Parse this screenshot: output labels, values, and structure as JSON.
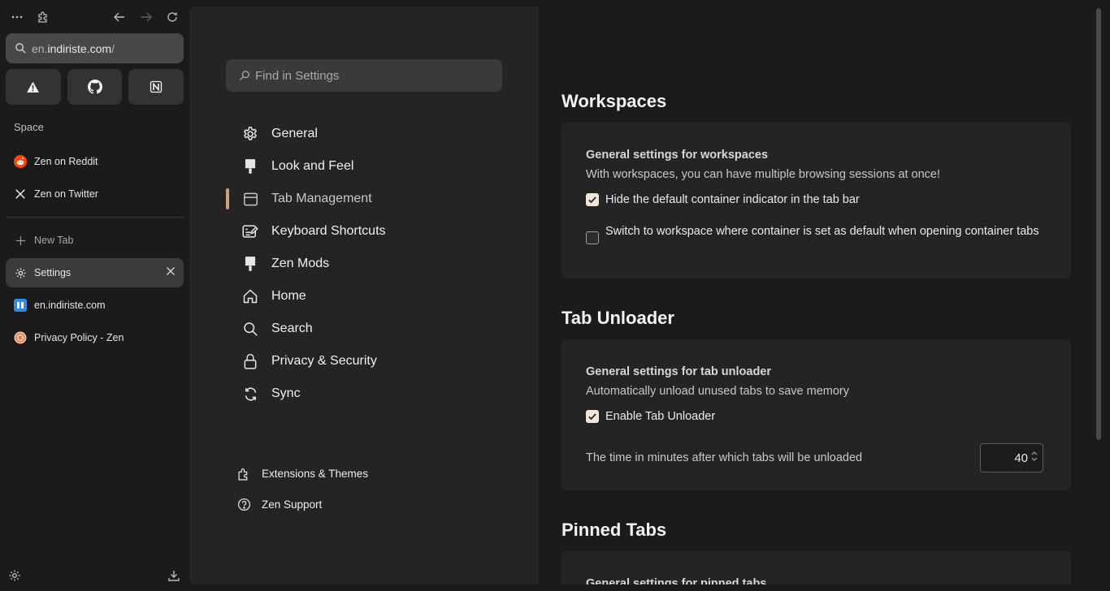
{
  "sidebar": {
    "url": {
      "prefix": "en.",
      "domain": "indiriste.com",
      "suffix": "/"
    },
    "pinned": [
      {
        "icon": "warning-icon"
      },
      {
        "icon": "github-icon"
      },
      {
        "icon": "notion-icon"
      }
    ],
    "space_label": "Space",
    "essentials": [
      {
        "label": "Zen on Reddit",
        "icon": "reddit-icon"
      },
      {
        "label": "Zen on Twitter",
        "icon": "x-twitter-icon"
      }
    ],
    "new_tab_label": "New Tab",
    "tabs": [
      {
        "label": "Settings",
        "icon": "gear-icon",
        "active": true
      },
      {
        "label": "en.indiriste.com",
        "icon": "site-icon"
      },
      {
        "label": "Privacy Policy - Zen",
        "icon": "zen-icon"
      }
    ]
  },
  "settings_nav": {
    "search_placeholder": "Find in Settings",
    "items": [
      {
        "label": "General",
        "icon": "gear-icon"
      },
      {
        "label": "Look and Feel",
        "icon": "paintbrush-icon"
      },
      {
        "label": "Tab Management",
        "icon": "window-icon",
        "selected": true
      },
      {
        "label": "Keyboard Shortcuts",
        "icon": "keyboard-edit-icon"
      },
      {
        "label": "Zen Mods",
        "icon": "paintbrush-icon"
      },
      {
        "label": "Home",
        "icon": "home-icon"
      },
      {
        "label": "Search",
        "icon": "search-icon"
      },
      {
        "label": "Privacy & Security",
        "icon": "lock-icon"
      },
      {
        "label": "Sync",
        "icon": "sync-icon"
      }
    ],
    "footer_links": [
      {
        "label": "Extensions & Themes",
        "icon": "puzzle-icon"
      },
      {
        "label": "Zen Support",
        "icon": "help-icon"
      }
    ]
  },
  "content": {
    "workspaces": {
      "title": "Workspaces",
      "card_title": "General settings for workspaces",
      "card_desc": "With workspaces, you can have multiple browsing sessions at once!",
      "options": [
        {
          "label": "Hide the default container indicator in the tab bar",
          "checked": true
        },
        {
          "label": "Switch to workspace where container is set as default when opening container tabs",
          "checked": false
        }
      ]
    },
    "tab_unloader": {
      "title": "Tab Unloader",
      "card_title": "General settings for tab unloader",
      "card_desc": "Automatically unload unused tabs to save memory",
      "enable_label": "Enable Tab Unloader",
      "enable_checked": true,
      "timeout_label": "The time in minutes after which tabs will be unloaded",
      "timeout_value": "40"
    },
    "pinned_tabs": {
      "title": "Pinned Tabs",
      "card_title": "General settings for pinned tabs"
    }
  },
  "colors": {
    "accent": "#d0a07a",
    "checkbox_on": "#f1e6dc",
    "panel": "#242424",
    "background": "#1b1b1b"
  }
}
